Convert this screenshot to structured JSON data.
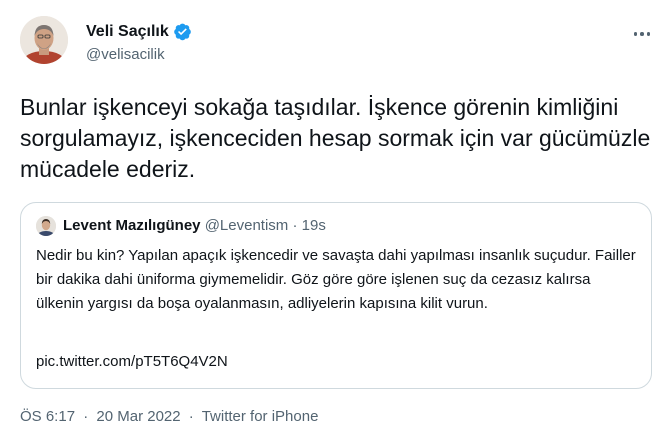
{
  "author": {
    "name": "Veli Saçılık",
    "handle": "@velisacilik"
  },
  "tweet": {
    "text": "Bunlar işkenceyi sokağa taşıdılar. İşkence görenin kimliğini sorgulamayız, işkenceciden hesap sormak için var gücümüzle mücadele ederiz."
  },
  "quoted": {
    "name": "Levent Mazılıgüney",
    "handle": "@Leventism",
    "separator": "·",
    "time": "19s",
    "text": "Nedir bu kin? Yapılan apaçık işkencedir ve savaşta dahi yapılması insanlık suçudur. Failler bir dakika dahi üniforma giymemelidir. Göz göre göre işlenen suç da cezasız kalırsa ülkenin yargısı da boşa oyalanmasın, adliyelerin kapısına kilit vurun.",
    "link": "pic.twitter.com/pT5T6Q4V2N"
  },
  "footer": {
    "time": "ÖS 6:17",
    "separator": "·",
    "date": "20 Mar 2022",
    "source": "Twitter for iPhone"
  },
  "colors": {
    "verified_blue": "#1d9bf0",
    "secondary_text": "#536471",
    "border": "#cfd9de"
  },
  "icons": [
    "verified-badge-icon",
    "more-options-icon"
  ]
}
